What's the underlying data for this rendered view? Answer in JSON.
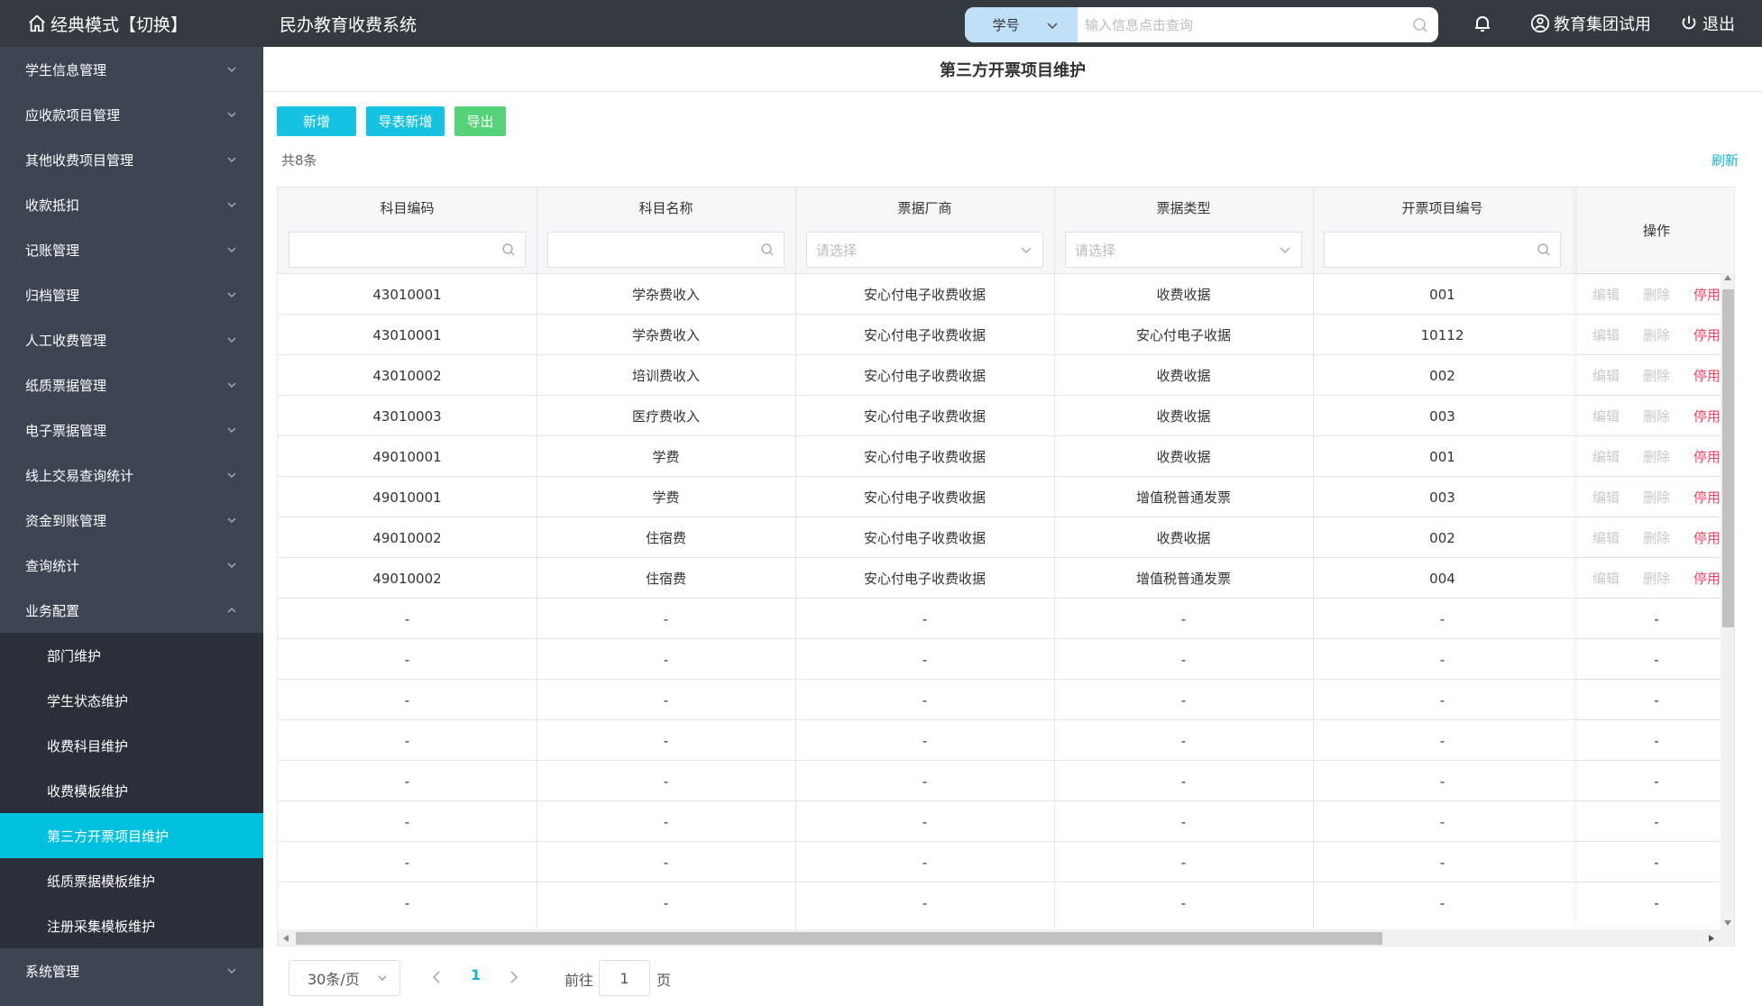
{
  "header": {
    "mode_label": "经典模式【切换】",
    "system_title": "民办教育收费系统",
    "search_type": "学号",
    "search_placeholder": "输入信息点击查询",
    "user_label": "教育集团试用",
    "logout_label": "退出"
  },
  "sidebar": {
    "items": [
      {
        "label": "学生信息管理"
      },
      {
        "label": "应收款项目管理"
      },
      {
        "label": "其他收费项目管理"
      },
      {
        "label": "收款抵扣"
      },
      {
        "label": "记账管理"
      },
      {
        "label": "归档管理"
      },
      {
        "label": "人工收费管理"
      },
      {
        "label": "纸质票据管理"
      },
      {
        "label": "电子票据管理"
      },
      {
        "label": "线上交易查询统计"
      },
      {
        "label": "资金到账管理"
      },
      {
        "label": "查询统计"
      },
      {
        "label": "业务配置"
      }
    ],
    "sub_items": [
      {
        "label": "部门维护"
      },
      {
        "label": "学生状态维护"
      },
      {
        "label": "收费科目维护"
      },
      {
        "label": "收费模板维护"
      },
      {
        "label": "第三方开票项目维护"
      },
      {
        "label": "纸质票据模板维护"
      },
      {
        "label": "注册采集模板维护"
      }
    ],
    "active_sub_index": 4,
    "last_item": {
      "label": "系统管理"
    }
  },
  "page": {
    "title": "第三方开票项目维护",
    "btn_add": "新增",
    "btn_import": "导表新增",
    "btn_export": "导出",
    "count_text": "共8条",
    "refresh_label": "刷新"
  },
  "table": {
    "columns": [
      "科目编码",
      "科目名称",
      "票据厂商",
      "票据类型",
      "开票项目编号"
    ],
    "op_header": "操作",
    "select_placeholder": "请选择",
    "op_labels": {
      "edit": "编辑",
      "delete": "删除",
      "disable": "停用"
    },
    "rows": [
      [
        "43010001",
        "学杂费收入",
        "安心付电子收费收据",
        "收费收据",
        "001"
      ],
      [
        "43010001",
        "学杂费收入",
        "安心付电子收费收据",
        "安心付电子收据",
        "10112"
      ],
      [
        "43010002",
        "培训费收入",
        "安心付电子收费收据",
        "收费收据",
        "002"
      ],
      [
        "43010003",
        "医疗费收入",
        "安心付电子收费收据",
        "收费收据",
        "003"
      ],
      [
        "49010001",
        "学费",
        "安心付电子收费收据",
        "收费收据",
        "001"
      ],
      [
        "49010001",
        "学费",
        "安心付电子收费收据",
        "增值税普通发票",
        "003"
      ],
      [
        "49010002",
        "住宿费",
        "安心付电子收费收据",
        "收费收据",
        "002"
      ],
      [
        "49010002",
        "住宿费",
        "安心付电子收费收据",
        "增值税普通发票",
        "004"
      ]
    ],
    "empty_rows": 8,
    "empty_cell": "-"
  },
  "pager": {
    "page_size": "30条/页",
    "current_page": "1",
    "goto_label": "前往",
    "goto_value": "1",
    "goto_unit": "页"
  }
}
